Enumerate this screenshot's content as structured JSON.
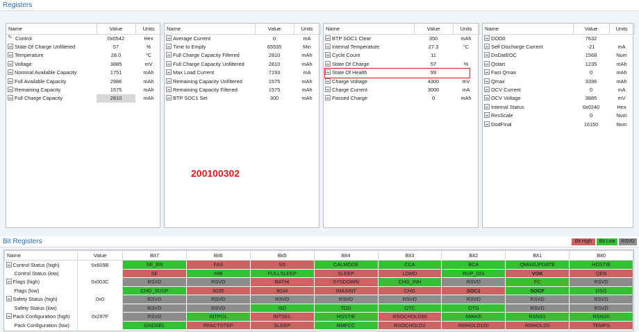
{
  "registers": {
    "title": "Registers",
    "col_name": "Name",
    "col_value": "Value",
    "col_units": "Units",
    "panels": [
      {
        "rows": [
          {
            "icon": "edit-icon",
            "name": "Control",
            "value": "0x0542",
            "units": "Hex"
          },
          {
            "icon": "register-icon",
            "name": "State Of Charge Unfiltered",
            "value": "57",
            "units": "%"
          },
          {
            "icon": "register-icon",
            "name": "Temperature",
            "value": "28.0",
            "units": "°C"
          },
          {
            "icon": "register-icon",
            "name": "Voltage",
            "value": "3885",
            "units": "mV"
          },
          {
            "icon": "register-icon",
            "name": "Nominal Available Capacity",
            "value": "1751",
            "units": "mAh"
          },
          {
            "icon": "register-icon",
            "name": "Full Available Capacity",
            "value": "2986",
            "units": "mAh"
          },
          {
            "icon": "register-icon",
            "name": "Remaining Capacity",
            "value": "1575",
            "units": "mAh"
          },
          {
            "icon": "register-icon",
            "name": "Full Charge Capacity",
            "value": "2810",
            "units": "mAh"
          }
        ]
      },
      {
        "rows": [
          {
            "icon": "register-icon",
            "name": "Average Current",
            "value": "0",
            "units": "mA"
          },
          {
            "icon": "register-icon",
            "name": "Time to Empty",
            "value": "65535",
            "units": "Min"
          },
          {
            "icon": "register-icon",
            "name": "Full Charge Capacity Filtered",
            "value": "2810",
            "units": "mAh"
          },
          {
            "icon": "register-icon",
            "name": "Full Charge Capacity Unfiltered",
            "value": "2810",
            "units": "mAh"
          },
          {
            "icon": "register-icon",
            "name": "Max Load Current",
            "value": "7193",
            "units": "mA"
          },
          {
            "icon": "register-icon",
            "name": "Remaining Capacity Unfiltered",
            "value": "1575",
            "units": "mAh"
          },
          {
            "icon": "register-icon",
            "name": "Remaining Capacity Filtered",
            "value": "1575",
            "units": "mAh"
          },
          {
            "icon": "register-icon",
            "name": "BTP SOC1 Set",
            "value": "300",
            "units": "mAh"
          }
        ]
      },
      {
        "rows": [
          {
            "icon": "register-icon",
            "name": "BTP SOC1 Clear",
            "value": "350",
            "units": "mAh"
          },
          {
            "icon": "register-icon",
            "name": "Internal Temperature",
            "value": "27.3",
            "units": "°C"
          },
          {
            "icon": "register-icon",
            "name": "Cycle Count",
            "value": "11",
            "units": ""
          },
          {
            "icon": "register-icon",
            "name": "State Of Charge",
            "value": "57",
            "units": "%"
          },
          {
            "icon": "register-icon",
            "name": "State Of Health",
            "value": "99",
            "units": ""
          },
          {
            "icon": "register-icon",
            "name": "Charge Voltage",
            "value": "4300",
            "units": "mV"
          },
          {
            "icon": "register-icon",
            "name": "Charge Current",
            "value": "3000",
            "units": "mA"
          },
          {
            "icon": "register-icon",
            "name": "Passed Charge",
            "value": "0",
            "units": "mAh"
          }
        ]
      },
      {
        "rows": [
          {
            "icon": "register-icon",
            "name": "DOD0",
            "value": "7632",
            "units": ""
          },
          {
            "icon": "register-icon",
            "name": "Self Discharge Current",
            "value": "-21",
            "units": "mA"
          },
          {
            "icon": "register-icon",
            "name": "DoDatEOC",
            "value": "1568",
            "units": "Num"
          },
          {
            "icon": "register-icon",
            "name": "Qstart",
            "value": "1235",
            "units": "mAh"
          },
          {
            "icon": "register-icon",
            "name": "Fast Qmax",
            "value": "0",
            "units": "mAh"
          },
          {
            "icon": "register-icon",
            "name": "Qmax",
            "value": "3336",
            "units": "mAh"
          },
          {
            "icon": "register-icon",
            "name": "OCV Current",
            "value": "0",
            "units": "mA"
          },
          {
            "icon": "register-icon",
            "name": "OCV Voltage",
            "value": "3885",
            "units": "mV"
          },
          {
            "icon": "register-icon",
            "name": "Internal Status",
            "value": "0x0240",
            "units": "Hex"
          },
          {
            "icon": "register-icon",
            "name": "ResScale",
            "value": "0",
            "units": "Num"
          },
          {
            "icon": "register-icon",
            "name": "DodFinal",
            "value": "16150",
            "units": "Num"
          }
        ]
      }
    ],
    "overlay_code": "200100302"
  },
  "bit_registers": {
    "title": "Bit Registers",
    "legend": {
      "high": "Bit High",
      "low": "Bit Low",
      "rsvd": "RSVD"
    },
    "colors": {
      "high": "#cc6262",
      "low": "#34bf34",
      "rsvd": "#8c8c8c"
    },
    "col_name": "Name",
    "col_value": "Value",
    "bit_headers": [
      "Bit7",
      "Bit6",
      "Bit5",
      "Bit4",
      "Bit3",
      "Bit2",
      "Bit1",
      "Bit0"
    ],
    "rows": [
      {
        "icon": true,
        "name": "Control Status (high)",
        "value": "0x609B",
        "bits": [
          [
            "SE_EN",
            "L"
          ],
          [
            "FAS",
            "H"
          ],
          [
            "SS",
            "H"
          ],
          [
            "CALMODE",
            "L"
          ],
          [
            "CCA",
            "L"
          ],
          [
            "BCA",
            "L"
          ],
          [
            "QMAXUPDATE",
            "L"
          ],
          [
            "HOSTIE",
            "L"
          ]
        ]
      },
      {
        "icon": false,
        "name": "Control Status (low)",
        "value": "",
        "bits": [
          [
            "SE",
            "H"
          ],
          [
            "HIB",
            "L"
          ],
          [
            "FULLSLEEP",
            "L"
          ],
          [
            "SLEEP",
            "H"
          ],
          [
            "LDMD",
            "H"
          ],
          [
            "RUP_DIS",
            "L"
          ],
          [
            "VOK",
            "H"
          ],
          [
            "QEN",
            "H"
          ]
        ]
      },
      {
        "icon": true,
        "name": "Flags (high)",
        "value": "0x003C",
        "bits": [
          [
            "RSVD",
            "R"
          ],
          [
            "RSVD",
            "R"
          ],
          [
            "BATHI",
            "H"
          ],
          [
            "SYSDOWN",
            "H"
          ],
          [
            "CHG_INH",
            "L"
          ],
          [
            "RSVD",
            "R"
          ],
          [
            "FC",
            "L"
          ],
          [
            "RSVD",
            "R"
          ]
        ]
      },
      {
        "icon": false,
        "name": "Flags (low)",
        "value": "",
        "bits": [
          [
            "CHG_SUSP",
            "L"
          ],
          [
            "8035",
            "H"
          ],
          [
            "8034",
            "H"
          ],
          [
            "IMAXINT",
            "H"
          ],
          [
            "CHG",
            "H"
          ],
          [
            "SOC1",
            "H"
          ],
          [
            "SOCF",
            "L"
          ],
          [
            "DSG",
            "L"
          ]
        ]
      },
      {
        "icon": true,
        "name": "Safety Status (high)",
        "value": "0x0",
        "bits": [
          [
            "RSVD",
            "R"
          ],
          [
            "RSVD",
            "R"
          ],
          [
            "RSVD",
            "R"
          ],
          [
            "RSVD",
            "R"
          ],
          [
            "RSVD",
            "R"
          ],
          [
            "RSVD",
            "R"
          ],
          [
            "RSVD",
            "R"
          ],
          [
            "RSVD",
            "R"
          ]
        ]
      },
      {
        "icon": false,
        "name": "Safety Status (low)",
        "value": "",
        "bits": [
          [
            "RSVD",
            "R"
          ],
          [
            "RSVD",
            "R"
          ],
          [
            "ISD",
            "L"
          ],
          [
            "TDD",
            "L"
          ],
          [
            "OTC",
            "L"
          ],
          [
            "OTD",
            "L"
          ],
          [
            "RSVD",
            "R"
          ],
          [
            "RSVD",
            "R"
          ]
        ]
      },
      {
        "icon": true,
        "name": "Pack Configuration (high)",
        "value": "0x297F",
        "bits": [
          [
            "RSVD",
            "R"
          ],
          [
            "INTPOL",
            "L"
          ],
          [
            "INTSEL",
            "H"
          ],
          [
            "HOSTIE",
            "L"
          ],
          [
            "RSOCHOLD99",
            "H"
          ],
          [
            "IWAKE",
            "L"
          ],
          [
            "RSNS1",
            "L"
          ],
          [
            "RSNS0",
            "L"
          ]
        ]
      },
      {
        "icon": false,
        "name": "Pack Configuration (low)",
        "value": "",
        "bits": [
          [
            "GNDSEL",
            "L"
          ],
          [
            "RFACTSTEP",
            "H"
          ],
          [
            "SLEEP",
            "H"
          ],
          [
            "RMFCC",
            "L"
          ],
          [
            "RSOCHOLD1",
            "H"
          ],
          [
            "RMHOLD100",
            "H"
          ],
          [
            "RMHOLD0",
            "H"
          ],
          [
            "TEMPS",
            "H"
          ]
        ]
      }
    ]
  }
}
